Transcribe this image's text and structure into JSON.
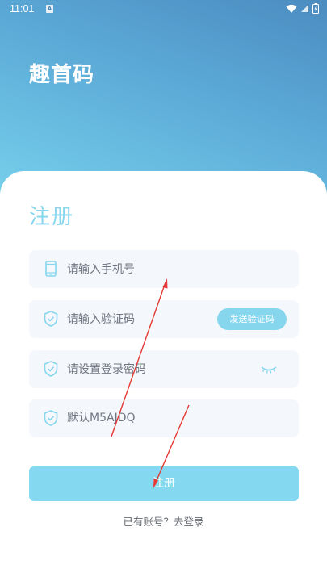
{
  "status_bar": {
    "time": "11:01",
    "notification_glyph": "A"
  },
  "header": {
    "app_title": "趣首码"
  },
  "form": {
    "title": "注册",
    "phone_placeholder": "请输入手机号",
    "code_placeholder": "请输入验证码",
    "send_code_label": "发送验证码",
    "password_placeholder": "请设置登录密码",
    "invite_value": "默认M5AJDQ",
    "submit_label": "注册",
    "login_link": "已有账号？去登录"
  },
  "colors": {
    "accent": "#86d6ee",
    "header_gradient_top": "#4c8cc0",
    "header_gradient_bottom": "#78d2ec",
    "annotation_arrow": "#e53935"
  }
}
